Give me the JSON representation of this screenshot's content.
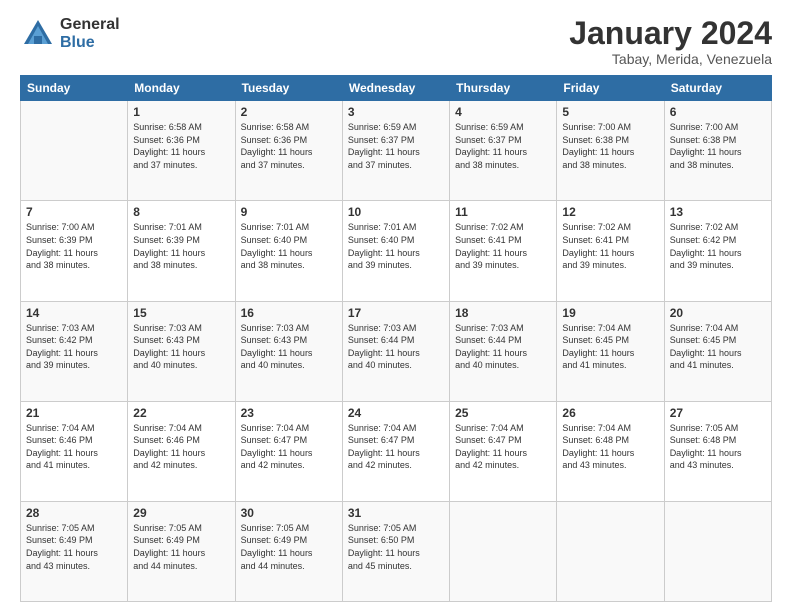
{
  "logo": {
    "general": "General",
    "blue": "Blue"
  },
  "title": "January 2024",
  "location": "Tabay, Merida, Venezuela",
  "days_of_week": [
    "Sunday",
    "Monday",
    "Tuesday",
    "Wednesday",
    "Thursday",
    "Friday",
    "Saturday"
  ],
  "weeks": [
    [
      {
        "day": "",
        "info": ""
      },
      {
        "day": "1",
        "info": "Sunrise: 6:58 AM\nSunset: 6:36 PM\nDaylight: 11 hours\nand 37 minutes."
      },
      {
        "day": "2",
        "info": "Sunrise: 6:58 AM\nSunset: 6:36 PM\nDaylight: 11 hours\nand 37 minutes."
      },
      {
        "day": "3",
        "info": "Sunrise: 6:59 AM\nSunset: 6:37 PM\nDaylight: 11 hours\nand 37 minutes."
      },
      {
        "day": "4",
        "info": "Sunrise: 6:59 AM\nSunset: 6:37 PM\nDaylight: 11 hours\nand 38 minutes."
      },
      {
        "day": "5",
        "info": "Sunrise: 7:00 AM\nSunset: 6:38 PM\nDaylight: 11 hours\nand 38 minutes."
      },
      {
        "day": "6",
        "info": "Sunrise: 7:00 AM\nSunset: 6:38 PM\nDaylight: 11 hours\nand 38 minutes."
      }
    ],
    [
      {
        "day": "7",
        "info": "Sunrise: 7:00 AM\nSunset: 6:39 PM\nDaylight: 11 hours\nand 38 minutes."
      },
      {
        "day": "8",
        "info": "Sunrise: 7:01 AM\nSunset: 6:39 PM\nDaylight: 11 hours\nand 38 minutes."
      },
      {
        "day": "9",
        "info": "Sunrise: 7:01 AM\nSunset: 6:40 PM\nDaylight: 11 hours\nand 38 minutes."
      },
      {
        "day": "10",
        "info": "Sunrise: 7:01 AM\nSunset: 6:40 PM\nDaylight: 11 hours\nand 39 minutes."
      },
      {
        "day": "11",
        "info": "Sunrise: 7:02 AM\nSunset: 6:41 PM\nDaylight: 11 hours\nand 39 minutes."
      },
      {
        "day": "12",
        "info": "Sunrise: 7:02 AM\nSunset: 6:41 PM\nDaylight: 11 hours\nand 39 minutes."
      },
      {
        "day": "13",
        "info": "Sunrise: 7:02 AM\nSunset: 6:42 PM\nDaylight: 11 hours\nand 39 minutes."
      }
    ],
    [
      {
        "day": "14",
        "info": "Sunrise: 7:03 AM\nSunset: 6:42 PM\nDaylight: 11 hours\nand 39 minutes."
      },
      {
        "day": "15",
        "info": "Sunrise: 7:03 AM\nSunset: 6:43 PM\nDaylight: 11 hours\nand 40 minutes."
      },
      {
        "day": "16",
        "info": "Sunrise: 7:03 AM\nSunset: 6:43 PM\nDaylight: 11 hours\nand 40 minutes."
      },
      {
        "day": "17",
        "info": "Sunrise: 7:03 AM\nSunset: 6:44 PM\nDaylight: 11 hours\nand 40 minutes."
      },
      {
        "day": "18",
        "info": "Sunrise: 7:03 AM\nSunset: 6:44 PM\nDaylight: 11 hours\nand 40 minutes."
      },
      {
        "day": "19",
        "info": "Sunrise: 7:04 AM\nSunset: 6:45 PM\nDaylight: 11 hours\nand 41 minutes."
      },
      {
        "day": "20",
        "info": "Sunrise: 7:04 AM\nSunset: 6:45 PM\nDaylight: 11 hours\nand 41 minutes."
      }
    ],
    [
      {
        "day": "21",
        "info": "Sunrise: 7:04 AM\nSunset: 6:46 PM\nDaylight: 11 hours\nand 41 minutes."
      },
      {
        "day": "22",
        "info": "Sunrise: 7:04 AM\nSunset: 6:46 PM\nDaylight: 11 hours\nand 42 minutes."
      },
      {
        "day": "23",
        "info": "Sunrise: 7:04 AM\nSunset: 6:47 PM\nDaylight: 11 hours\nand 42 minutes."
      },
      {
        "day": "24",
        "info": "Sunrise: 7:04 AM\nSunset: 6:47 PM\nDaylight: 11 hours\nand 42 minutes."
      },
      {
        "day": "25",
        "info": "Sunrise: 7:04 AM\nSunset: 6:47 PM\nDaylight: 11 hours\nand 42 minutes."
      },
      {
        "day": "26",
        "info": "Sunrise: 7:04 AM\nSunset: 6:48 PM\nDaylight: 11 hours\nand 43 minutes."
      },
      {
        "day": "27",
        "info": "Sunrise: 7:05 AM\nSunset: 6:48 PM\nDaylight: 11 hours\nand 43 minutes."
      }
    ],
    [
      {
        "day": "28",
        "info": "Sunrise: 7:05 AM\nSunset: 6:49 PM\nDaylight: 11 hours\nand 43 minutes."
      },
      {
        "day": "29",
        "info": "Sunrise: 7:05 AM\nSunset: 6:49 PM\nDaylight: 11 hours\nand 44 minutes."
      },
      {
        "day": "30",
        "info": "Sunrise: 7:05 AM\nSunset: 6:49 PM\nDaylight: 11 hours\nand 44 minutes."
      },
      {
        "day": "31",
        "info": "Sunrise: 7:05 AM\nSunset: 6:50 PM\nDaylight: 11 hours\nand 45 minutes."
      },
      {
        "day": "",
        "info": ""
      },
      {
        "day": "",
        "info": ""
      },
      {
        "day": "",
        "info": ""
      }
    ]
  ]
}
